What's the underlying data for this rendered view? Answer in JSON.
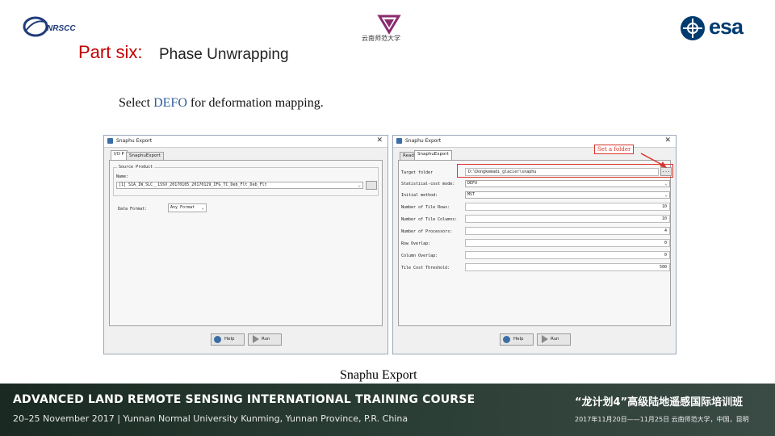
{
  "header": {
    "nrscc_logo_text": "NRSCC",
    "university_logo_text": "云南师范大学",
    "esa_logo_text": "esa",
    "part_title": "Part six:",
    "part_subtitle": "Phase Unwrapping"
  },
  "instruction": {
    "before": "Select ",
    "highlight": "DEFO",
    "after": " for deformation mapping."
  },
  "dialog_left": {
    "title": "Snaphu Export",
    "tabs": [
      "I/O P",
      "SnaphuExport"
    ],
    "section_label": "Source Product",
    "name_label": "Name:",
    "product_value": "[1] S1A_IW_SLC__1SSV_20170105_20170129_IFG_TC_Deb_Flt_Deb_Flt",
    "format_label": "Data Format:",
    "format_value": "Any Format",
    "buttons": {
      "help": "Help",
      "run": "Run"
    }
  },
  "dialog_right": {
    "title": "Snaphu Export",
    "tabs": [
      "Read",
      "SnaphuExport"
    ],
    "fields": [
      {
        "label": "Target folder",
        "value": "D:\\Dongkemadi_glacier\\snaphu"
      },
      {
        "label": "Statistical-cost mode:",
        "value": "DEFO"
      },
      {
        "label": "Initial method:",
        "value": "MST"
      },
      {
        "label": "Number of Tile Rows:",
        "value": "10"
      },
      {
        "label": "Number of Tile Columns:",
        "value": "10"
      },
      {
        "label": "Number of Processors:",
        "value": "4"
      },
      {
        "label": "Row Overlap:",
        "value": "0"
      },
      {
        "label": "Column Overlap:",
        "value": "0"
      },
      {
        "label": "Tile Cost Threshold:",
        "value": "500"
      }
    ],
    "browse_label": "...",
    "callout": "Set a folder",
    "buttons": {
      "help": "Help",
      "run": "Run"
    }
  },
  "caption": "Snaphu Export",
  "footer": {
    "line1": "ADVANCED LAND REMOTE SENSING INTERNATIONAL TRAINING COURSE",
    "line2": "20–25 November 2017 | Yunnan Normal University Kunming, Yunnan Province, P.R. China",
    "cn_line1": "“龙计划4”高级陆地遥感国际培训班",
    "cn_line2": "2017年11月20日——11月25日 云南师范大学，中国，昆明"
  },
  "colors": {
    "accent_red": "#c00000",
    "highlight_blue": "#2e5d9e",
    "callout_red": "#d9342b",
    "footer_bg": "#2a3d34"
  }
}
